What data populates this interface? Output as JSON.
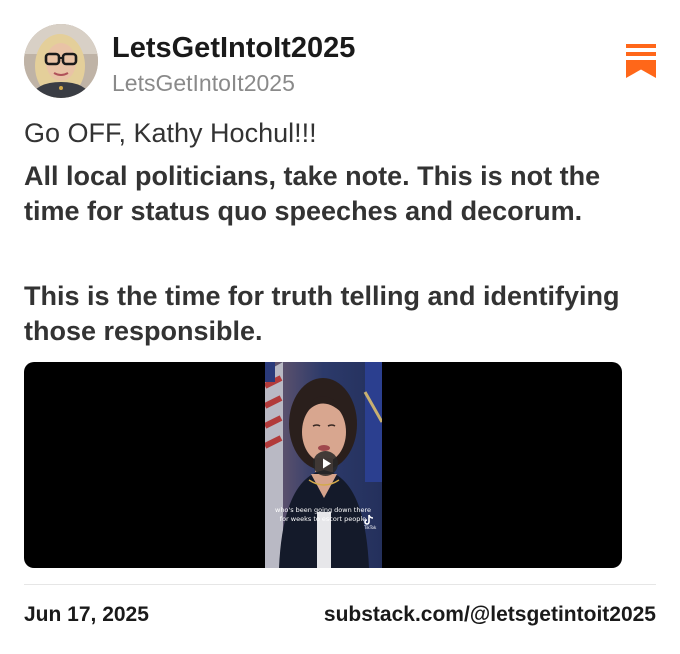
{
  "author": {
    "display_name": "LetsGetIntoIt2025",
    "handle": "LetsGetIntoIt2025",
    "avatar_icon": "avatar-photo"
  },
  "brand": {
    "logo_icon": "substack-logo-icon",
    "accent_color": "#FF6719"
  },
  "post": {
    "intro": "Go OFF, Kathy Hochul!!!",
    "paragraphs": [
      "All local politicians, take note. This is not the time for status quo speeches and decorum.",
      "This is the time for truth telling and identifying those responsible."
    ],
    "video": {
      "caption_line_1": "who's been going down there",
      "caption_line_2": "for weeks to escort people",
      "watermark": "TikTok",
      "play_icon": "play-icon"
    }
  },
  "footer": {
    "date": "Jun 17, 2025",
    "link": "substack.com/@letsgetintoit2025"
  }
}
